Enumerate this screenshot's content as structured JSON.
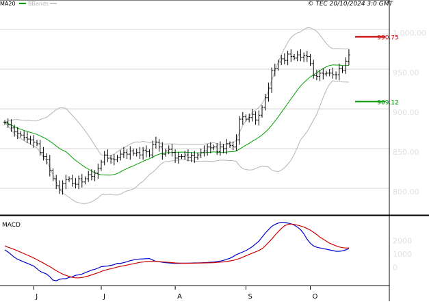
{
  "header": {
    "legend_ma": "MA20",
    "legend_bb": "BBands",
    "copyright": "© TEC 20/10/2024 3:0 GMT"
  },
  "colors": {
    "price": "#000000",
    "ma": "#00a000",
    "bands": "#b4b4b4",
    "resistance": "#cc0000",
    "support": "#009900",
    "macd": "#0000cc",
    "signal": "#cc0000",
    "grid": "#d4d4d4",
    "tick_label": "#e0e0e0",
    "frame": "#000000"
  },
  "chart_data": [
    {
      "type": "ohlc",
      "title": "",
      "xlabel": "",
      "ylabel": "",
      "ylim": [
        775,
        1025
      ],
      "yticks": [
        {
          "value": 1000,
          "label": "1 000.00"
        },
        {
          "value": 950,
          "label": "950.00"
        },
        {
          "value": 900,
          "label": "900.00"
        },
        {
          "value": 850,
          "label": "850.00"
        },
        {
          "value": 800,
          "label": "800.00"
        }
      ],
      "x_month_labels": [
        {
          "label": "J",
          "bar": 9
        },
        {
          "label": "J",
          "bar": 30
        },
        {
          "label": "A",
          "bar": 53
        },
        {
          "label": "S",
          "bar": 75
        },
        {
          "label": "O",
          "bar": 95
        }
      ],
      "grid": true,
      "legend": "top-left",
      "levels": [
        {
          "value": 990.75,
          "label": "990.75",
          "role": "resistance"
        },
        {
          "value": 909.12,
          "label": "909.12",
          "role": "support"
        }
      ],
      "close": [
        883,
        880,
        876,
        871,
        869,
        867,
        864,
        862,
        861,
        858,
        856,
        845,
        840,
        836,
        822,
        812,
        803,
        798,
        806,
        811,
        812,
        806,
        805,
        812,
        808,
        812,
        817,
        815,
        819,
        825,
        833,
        842,
        838,
        837,
        836,
        839,
        843,
        845,
        843,
        847,
        844,
        845,
        842,
        848,
        846,
        842,
        855,
        858,
        852,
        843,
        847,
        849,
        845,
        838,
        840,
        840,
        842,
        839,
        841,
        839,
        842,
        845,
        847,
        852,
        851,
        852,
        846,
        852,
        850,
        856,
        854,
        852,
        861,
        887,
        890,
        887,
        889,
        893,
        886,
        892,
        902,
        914,
        926,
        948,
        951,
        959,
        963,
        961,
        969,
        966,
        964,
        968,
        965,
        967,
        966,
        957,
        942,
        941,
        945,
        944,
        945,
        945,
        943,
        943,
        951,
        948,
        960,
        968
      ]
    },
    {
      "type": "line",
      "title": "MACD",
      "xlabel": "",
      "ylabel": "",
      "ylim": [
        -1200,
        3700
      ],
      "yticks": [
        {
          "value": 2000,
          "label": "2000"
        },
        {
          "value": 1000,
          "label": "1000"
        },
        {
          "value": 0,
          "label": "0"
        }
      ],
      "grid": false,
      "series": [
        {
          "name": "",
          "role": "macd",
          "values": [
            1300,
            1150,
            950,
            750,
            600,
            500,
            400,
            300,
            200,
            100,
            -100,
            -300,
            -400,
            -500,
            -700,
            -950,
            -1000,
            -900,
            -850,
            -850,
            -750,
            -700,
            -600,
            -550,
            -500,
            -400,
            -300,
            -200,
            -150,
            -50,
            50,
            80,
            100,
            150,
            200,
            300,
            300,
            350,
            420,
            500,
            550,
            600,
            620,
            630,
            650,
            660,
            550,
            450,
            420,
            380,
            350,
            330,
            310,
            300,
            300,
            305,
            310,
            315,
            320,
            330,
            330,
            340,
            350,
            360,
            380,
            400,
            430,
            470,
            520,
            600,
            680,
            800,
            950,
            1050,
            1150,
            1250,
            1400,
            1550,
            1750,
            1950,
            2250,
            2550,
            2800,
            3050,
            3200,
            3300,
            3350,
            3350,
            3300,
            3250,
            3150,
            3000,
            2800,
            2500,
            2100,
            1800,
            1600,
            1500,
            1450,
            1400,
            1350,
            1300,
            1250,
            1200,
            1200,
            1230,
            1300,
            1400
          ]
        },
        {
          "name": "",
          "role": "signal",
          "values": [
            1600,
            1500,
            1420,
            1330,
            1230,
            1130,
            1020,
            920,
            810,
            700,
            580,
            450,
            320,
            180,
            60,
            -100,
            -250,
            -380,
            -500,
            -600,
            -680,
            -740,
            -780,
            -780,
            -760,
            -700,
            -640,
            -560,
            -480,
            -400,
            -300,
            -220,
            -160,
            -100,
            -40,
            20,
            70,
            120,
            170,
            220,
            270,
            320,
            370,
            400,
            430,
            450,
            460,
            450,
            430,
            410,
            390,
            370,
            350,
            330,
            320,
            310,
            305,
            305,
            310,
            315,
            320,
            325,
            330,
            335,
            340,
            350,
            370,
            390,
            410,
            440,
            480,
            520,
            580,
            660,
            760,
            860,
            960,
            1060,
            1160,
            1260,
            1400,
            1600,
            1850,
            2100,
            2400,
            2650,
            2900,
            3100,
            3200,
            3230,
            3200,
            3150,
            3080,
            3000,
            2900,
            2780,
            2620,
            2450,
            2250,
            2100,
            1950,
            1800,
            1700,
            1600,
            1520,
            1470,
            1440,
            1450
          ]
        }
      ]
    }
  ]
}
